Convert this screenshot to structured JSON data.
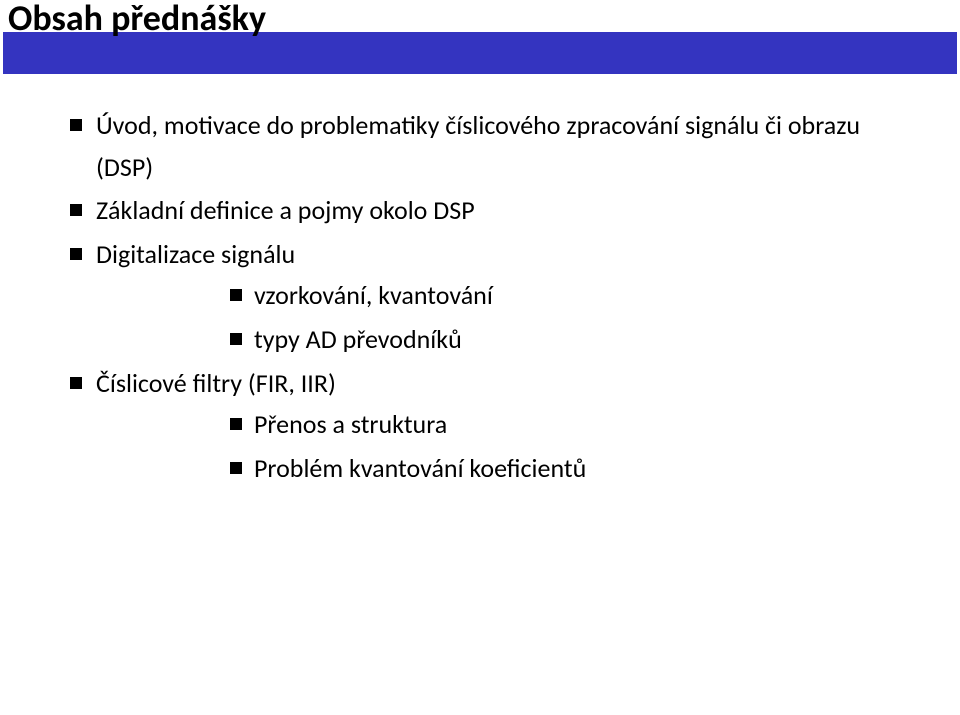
{
  "title": "Obsah přednášky",
  "bullets": [
    {
      "text": "Úvod, motivace do problematiky číslicového zpracování signálu či obrazu (DSP)"
    },
    {
      "text": "Základní definice a pojmy okolo DSP"
    },
    {
      "text": "Digitalizace signálu",
      "sub": [
        {
          "text": "vzorkování, kvantování"
        },
        {
          "text": "typy AD převodníků"
        }
      ]
    },
    {
      "text": "Číslicové filtry (FIR, IIR)",
      "sub": [
        {
          "text": "Přenos a struktura"
        },
        {
          "text": "Problém kvantování koeficientů"
        }
      ]
    }
  ]
}
